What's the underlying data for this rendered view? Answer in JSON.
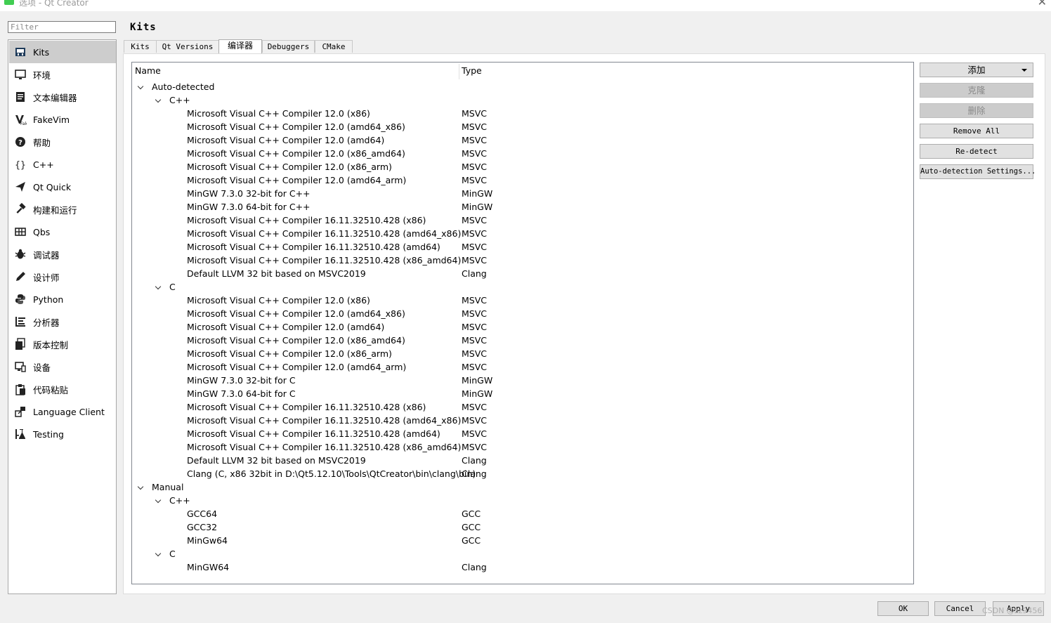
{
  "window": {
    "title": "选项 - Qt Creator"
  },
  "filter": {
    "placeholder": "Filter"
  },
  "sidebar": {
    "items": [
      {
        "label": "Kits",
        "icon": "kits-icon",
        "selected": true
      },
      {
        "label": "环境",
        "icon": "monitor-icon"
      },
      {
        "label": "文本编辑器",
        "icon": "text-editor-icon"
      },
      {
        "label": "FakeVim",
        "icon": "fakevim-icon"
      },
      {
        "label": "帮助",
        "icon": "help-icon"
      },
      {
        "label": "C++",
        "icon": "braces-icon"
      },
      {
        "label": "Qt Quick",
        "icon": "paper-plane-icon"
      },
      {
        "label": "构建和运行",
        "icon": "hammer-icon"
      },
      {
        "label": "Qbs",
        "icon": "grid-icon"
      },
      {
        "label": "调试器",
        "icon": "bug-icon"
      },
      {
        "label": "设计师",
        "icon": "pen-icon"
      },
      {
        "label": "Python",
        "icon": "python-icon"
      },
      {
        "label": "分析器",
        "icon": "analyzer-icon"
      },
      {
        "label": "版本控制",
        "icon": "version-control-icon"
      },
      {
        "label": "设备",
        "icon": "device-icon"
      },
      {
        "label": "代码粘贴",
        "icon": "paste-icon"
      },
      {
        "label": "Language Client",
        "icon": "language-client-icon"
      },
      {
        "label": "Testing",
        "icon": "flask-icon"
      }
    ]
  },
  "page": {
    "title": "Kits"
  },
  "tabs": [
    {
      "label": "Kits"
    },
    {
      "label": "Qt Versions"
    },
    {
      "label": "编译器",
      "active": true
    },
    {
      "label": "Debuggers"
    },
    {
      "label": "CMake"
    }
  ],
  "tree": {
    "columns": {
      "name": "Name",
      "type": "Type"
    },
    "rows": [
      {
        "level": 0,
        "name": "Auto-detected",
        "type": "",
        "expanded": true
      },
      {
        "level": 1,
        "name": "C++",
        "type": "",
        "expanded": true
      },
      {
        "level": 2,
        "name": "Microsoft Visual C++ Compiler 12.0 (x86)",
        "type": "MSVC"
      },
      {
        "level": 2,
        "name": "Microsoft Visual C++ Compiler 12.0 (amd64_x86)",
        "type": "MSVC"
      },
      {
        "level": 2,
        "name": "Microsoft Visual C++ Compiler 12.0 (amd64)",
        "type": "MSVC"
      },
      {
        "level": 2,
        "name": "Microsoft Visual C++ Compiler 12.0 (x86_amd64)",
        "type": "MSVC"
      },
      {
        "level": 2,
        "name": "Microsoft Visual C++ Compiler 12.0 (x86_arm)",
        "type": "MSVC"
      },
      {
        "level": 2,
        "name": "Microsoft Visual C++ Compiler 12.0 (amd64_arm)",
        "type": "MSVC"
      },
      {
        "level": 2,
        "name": "MinGW 7.3.0 32-bit for C++",
        "type": "MinGW"
      },
      {
        "level": 2,
        "name": "MinGW 7.3.0 64-bit for C++",
        "type": "MinGW"
      },
      {
        "level": 2,
        "name": "Microsoft Visual C++ Compiler 16.11.32510.428 (x86)",
        "type": "MSVC"
      },
      {
        "level": 2,
        "name": "Microsoft Visual C++ Compiler 16.11.32510.428 (amd64_x86)",
        "type": "MSVC"
      },
      {
        "level": 2,
        "name": "Microsoft Visual C++ Compiler 16.11.32510.428 (amd64)",
        "type": "MSVC"
      },
      {
        "level": 2,
        "name": "Microsoft Visual C++ Compiler 16.11.32510.428 (x86_amd64)",
        "type": "MSVC"
      },
      {
        "level": 2,
        "name": "Default LLVM 32 bit based on MSVC2019",
        "type": "Clang"
      },
      {
        "level": 1,
        "name": "C",
        "type": "",
        "expanded": true
      },
      {
        "level": 2,
        "name": "Microsoft Visual C++ Compiler 12.0 (x86)",
        "type": "MSVC"
      },
      {
        "level": 2,
        "name": "Microsoft Visual C++ Compiler 12.0 (amd64_x86)",
        "type": "MSVC"
      },
      {
        "level": 2,
        "name": "Microsoft Visual C++ Compiler 12.0 (amd64)",
        "type": "MSVC"
      },
      {
        "level": 2,
        "name": "Microsoft Visual C++ Compiler 12.0 (x86_amd64)",
        "type": "MSVC"
      },
      {
        "level": 2,
        "name": "Microsoft Visual C++ Compiler 12.0 (x86_arm)",
        "type": "MSVC"
      },
      {
        "level": 2,
        "name": "Microsoft Visual C++ Compiler 12.0 (amd64_arm)",
        "type": "MSVC"
      },
      {
        "level": 2,
        "name": "MinGW 7.3.0 32-bit for C",
        "type": "MinGW"
      },
      {
        "level": 2,
        "name": "MinGW 7.3.0 64-bit for C",
        "type": "MinGW"
      },
      {
        "level": 2,
        "name": "Microsoft Visual C++ Compiler 16.11.32510.428 (x86)",
        "type": "MSVC"
      },
      {
        "level": 2,
        "name": "Microsoft Visual C++ Compiler 16.11.32510.428 (amd64_x86)",
        "type": "MSVC"
      },
      {
        "level": 2,
        "name": "Microsoft Visual C++ Compiler 16.11.32510.428 (amd64)",
        "type": "MSVC"
      },
      {
        "level": 2,
        "name": "Microsoft Visual C++ Compiler 16.11.32510.428 (x86_amd64)",
        "type": "MSVC"
      },
      {
        "level": 2,
        "name": "Default LLVM 32 bit based on MSVC2019",
        "type": "Clang"
      },
      {
        "level": 2,
        "name": "Clang (C, x86 32bit in D:\\Qt5.12.10\\Tools\\QtCreator\\bin\\clang\\bin)",
        "type": "Clang"
      },
      {
        "level": 0,
        "name": "Manual",
        "type": "",
        "expanded": true
      },
      {
        "level": 1,
        "name": "C++",
        "type": "",
        "expanded": true
      },
      {
        "level": 2,
        "name": "GCC64",
        "type": "GCC"
      },
      {
        "level": 2,
        "name": "GCC32",
        "type": "GCC"
      },
      {
        "level": 2,
        "name": "MinGw64",
        "type": "GCC"
      },
      {
        "level": 1,
        "name": "C",
        "type": "",
        "expanded": true
      },
      {
        "level": 2,
        "name": "MinGW64",
        "type": "Clang"
      }
    ]
  },
  "actions": {
    "add": "添加",
    "clone": "克隆",
    "delete": "删除",
    "remove_all": "Remove All",
    "redetect": "Re-detect",
    "auto_detection_settings": "Auto-detection Settings..."
  },
  "dialog": {
    "ok": "OK",
    "cancel": "Cancel",
    "apply": "Apply"
  },
  "watermark": "CSDN @zz9456",
  "colors": {
    "selection": "#cdcdcd",
    "button_face": "#e1e1e1",
    "disabled_button": "#cccccc"
  }
}
